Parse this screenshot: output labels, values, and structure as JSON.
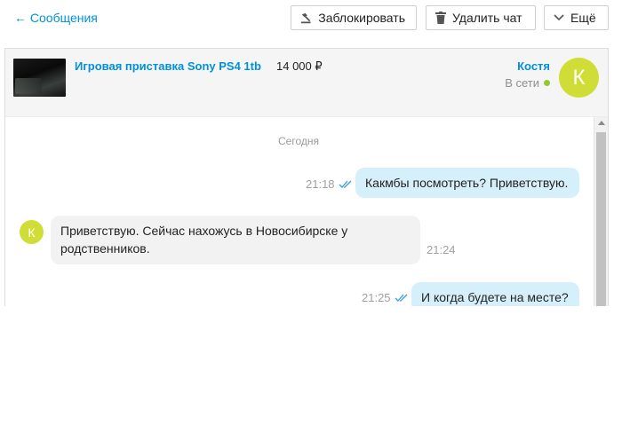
{
  "nav": {
    "back_label": "← Сообщения"
  },
  "toolbar": {
    "block_label": "Заблокировать",
    "delete_label": "Удалить чат",
    "more_label": "Ещё"
  },
  "listing": {
    "title": "Игровая приставка Sony PS4 1tb",
    "price": "14 000 ₽"
  },
  "contact": {
    "name": "Костя",
    "status": "В сети",
    "avatar_letter": "К"
  },
  "chat": {
    "date_separator": "Сегодня",
    "messages": [
      {
        "direction": "out",
        "text": "Какмбы посмотреть? Приветствую.",
        "time": "21:18",
        "read": true
      },
      {
        "direction": "in",
        "text": "Приветствую. Сейчас нахожусь в Новосибирске у родственников.",
        "time": "21:24",
        "avatar_letter": "К"
      },
      {
        "direction": "out",
        "text": "И когда будете на месте?",
        "time": "21:25",
        "read": true
      }
    ]
  },
  "colors": {
    "accent": "#0091d9",
    "outgoing_bubble": "#d6f0fb",
    "incoming_bubble": "#f2f2f2",
    "avatar": "#d0dd37",
    "online": "#8fcb2d"
  }
}
